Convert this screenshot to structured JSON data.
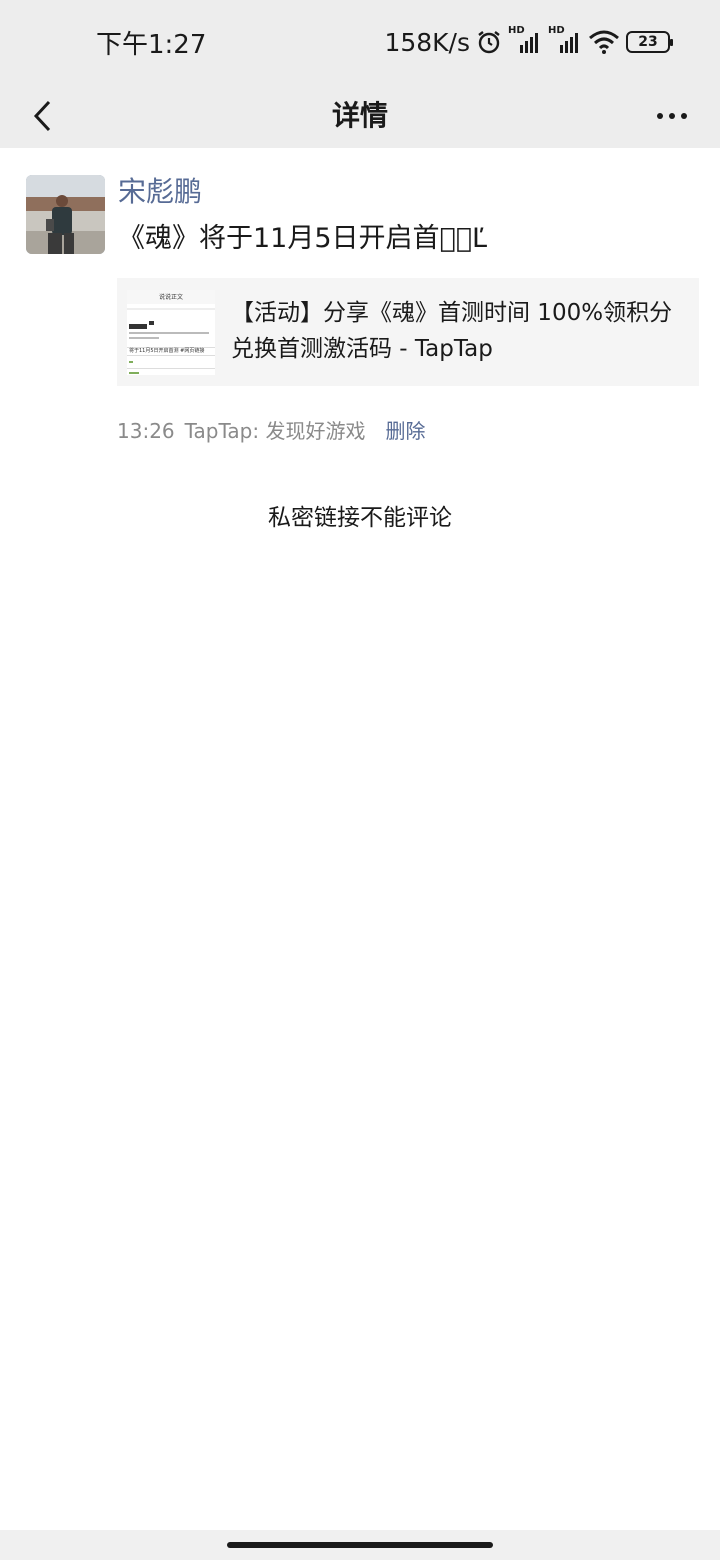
{
  "status_bar": {
    "time": "下午1:27",
    "net_speed": "158K/s",
    "signal_1_label": "HD",
    "signal_2_label": "HD",
    "battery_level": "23"
  },
  "nav": {
    "title": "详情"
  },
  "post": {
    "author": "宋彪鹏",
    "text": "《魂》将于11月5日开启首测ᷮĽ",
    "link_card": {
      "title": "【活动】分享《魂》首测时间 100%领积分兑换首测激活码 - TapTap",
      "thumb_heading": "说说正文",
      "thumb_line": "将于11月5日开启首测 #网页链接"
    },
    "meta": {
      "time": "13:26",
      "source": "TapTap: 发现好游戏",
      "delete_label": "删除"
    },
    "no_comment_text": "私密链接不能评论"
  },
  "colors": {
    "header_bg": "#ededed",
    "link_blue": "#576b95",
    "card_bg": "#f5f5f5"
  }
}
